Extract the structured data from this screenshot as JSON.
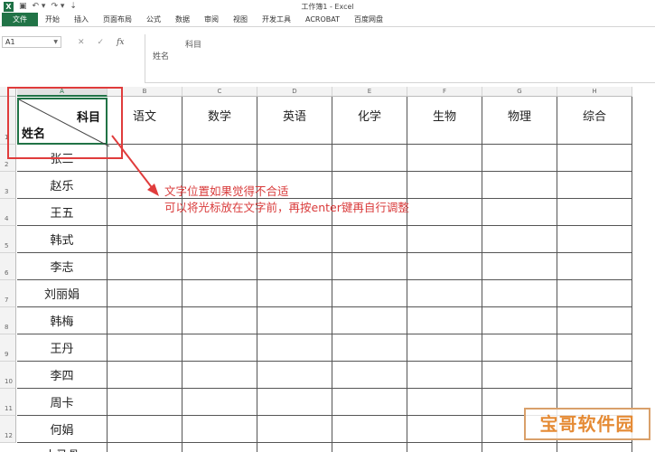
{
  "window": {
    "title": "工作簿1 - Excel",
    "app_logo": "X"
  },
  "quick_access": {
    "icons": [
      "save-icon",
      "undo-icon",
      "redo-icon",
      "customize-icon"
    ]
  },
  "ribbon": {
    "tabs": [
      {
        "label": "文件",
        "active": true
      },
      {
        "label": "开始"
      },
      {
        "label": "插入"
      },
      {
        "label": "页面布局"
      },
      {
        "label": "公式"
      },
      {
        "label": "数据"
      },
      {
        "label": "审阅"
      },
      {
        "label": "视图"
      },
      {
        "label": "开发工具"
      },
      {
        "label": "ACROBAT"
      },
      {
        "label": "百度网盘"
      }
    ]
  },
  "formula_bar": {
    "name_box": "A1",
    "cancel_symbol": "✕",
    "enter_symbol": "✓",
    "fx_symbol": "fx",
    "content_line1": "科目",
    "content_line2": "姓名"
  },
  "grid": {
    "columns": [
      "A",
      "B",
      "C",
      "D",
      "E",
      "F",
      "G",
      "H"
    ],
    "row_numbers": [
      "1",
      "2",
      "3",
      "4",
      "5",
      "6",
      "7",
      "8",
      "9",
      "10",
      "11",
      "12"
    ],
    "header_cell": {
      "subject_label": "科目",
      "name_label": "姓名"
    },
    "subjects": [
      "语文",
      "数学",
      "英语",
      "化学",
      "生物",
      "物理",
      "综合"
    ],
    "names": [
      "张三",
      "赵乐",
      "王五",
      "韩式",
      "李志",
      "刘丽娟",
      "韩梅",
      "王丹",
      "李四",
      "周卡",
      "何娟",
      "小马骨"
    ]
  },
  "annotation": {
    "line1": "文字位置如果觉得不合适",
    "line2": "可以将光标放在文字前，再按enter键再自行调整",
    "color": "#d93b3b"
  },
  "watermark": {
    "text": "宝哥软件园"
  },
  "colors": {
    "excel_green": "#217346",
    "annotation_red": "#e03c3c",
    "watermark_orange": "#e58b35"
  }
}
